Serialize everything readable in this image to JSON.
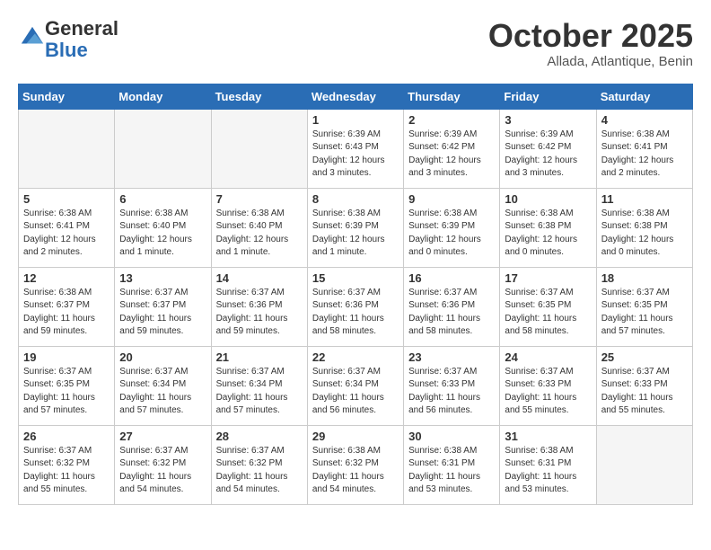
{
  "logo": {
    "general": "General",
    "blue": "Blue"
  },
  "header": {
    "month": "October 2025",
    "location": "Allada, Atlantique, Benin"
  },
  "weekdays": [
    "Sunday",
    "Monday",
    "Tuesday",
    "Wednesday",
    "Thursday",
    "Friday",
    "Saturday"
  ],
  "weeks": [
    [
      {
        "day": "",
        "info": ""
      },
      {
        "day": "",
        "info": ""
      },
      {
        "day": "",
        "info": ""
      },
      {
        "day": "1",
        "info": "Sunrise: 6:39 AM\nSunset: 6:43 PM\nDaylight: 12 hours\nand 3 minutes."
      },
      {
        "day": "2",
        "info": "Sunrise: 6:39 AM\nSunset: 6:42 PM\nDaylight: 12 hours\nand 3 minutes."
      },
      {
        "day": "3",
        "info": "Sunrise: 6:39 AM\nSunset: 6:42 PM\nDaylight: 12 hours\nand 3 minutes."
      },
      {
        "day": "4",
        "info": "Sunrise: 6:38 AM\nSunset: 6:41 PM\nDaylight: 12 hours\nand 2 minutes."
      }
    ],
    [
      {
        "day": "5",
        "info": "Sunrise: 6:38 AM\nSunset: 6:41 PM\nDaylight: 12 hours\nand 2 minutes."
      },
      {
        "day": "6",
        "info": "Sunrise: 6:38 AM\nSunset: 6:40 PM\nDaylight: 12 hours\nand 1 minute."
      },
      {
        "day": "7",
        "info": "Sunrise: 6:38 AM\nSunset: 6:40 PM\nDaylight: 12 hours\nand 1 minute."
      },
      {
        "day": "8",
        "info": "Sunrise: 6:38 AM\nSunset: 6:39 PM\nDaylight: 12 hours\nand 1 minute."
      },
      {
        "day": "9",
        "info": "Sunrise: 6:38 AM\nSunset: 6:39 PM\nDaylight: 12 hours\nand 0 minutes."
      },
      {
        "day": "10",
        "info": "Sunrise: 6:38 AM\nSunset: 6:38 PM\nDaylight: 12 hours\nand 0 minutes."
      },
      {
        "day": "11",
        "info": "Sunrise: 6:38 AM\nSunset: 6:38 PM\nDaylight: 12 hours\nand 0 minutes."
      }
    ],
    [
      {
        "day": "12",
        "info": "Sunrise: 6:38 AM\nSunset: 6:37 PM\nDaylight: 11 hours\nand 59 minutes."
      },
      {
        "day": "13",
        "info": "Sunrise: 6:37 AM\nSunset: 6:37 PM\nDaylight: 11 hours\nand 59 minutes."
      },
      {
        "day": "14",
        "info": "Sunrise: 6:37 AM\nSunset: 6:36 PM\nDaylight: 11 hours\nand 59 minutes."
      },
      {
        "day": "15",
        "info": "Sunrise: 6:37 AM\nSunset: 6:36 PM\nDaylight: 11 hours\nand 58 minutes."
      },
      {
        "day": "16",
        "info": "Sunrise: 6:37 AM\nSunset: 6:36 PM\nDaylight: 11 hours\nand 58 minutes."
      },
      {
        "day": "17",
        "info": "Sunrise: 6:37 AM\nSunset: 6:35 PM\nDaylight: 11 hours\nand 58 minutes."
      },
      {
        "day": "18",
        "info": "Sunrise: 6:37 AM\nSunset: 6:35 PM\nDaylight: 11 hours\nand 57 minutes."
      }
    ],
    [
      {
        "day": "19",
        "info": "Sunrise: 6:37 AM\nSunset: 6:35 PM\nDaylight: 11 hours\nand 57 minutes."
      },
      {
        "day": "20",
        "info": "Sunrise: 6:37 AM\nSunset: 6:34 PM\nDaylight: 11 hours\nand 57 minutes."
      },
      {
        "day": "21",
        "info": "Sunrise: 6:37 AM\nSunset: 6:34 PM\nDaylight: 11 hours\nand 57 minutes."
      },
      {
        "day": "22",
        "info": "Sunrise: 6:37 AM\nSunset: 6:34 PM\nDaylight: 11 hours\nand 56 minutes."
      },
      {
        "day": "23",
        "info": "Sunrise: 6:37 AM\nSunset: 6:33 PM\nDaylight: 11 hours\nand 56 minutes."
      },
      {
        "day": "24",
        "info": "Sunrise: 6:37 AM\nSunset: 6:33 PM\nDaylight: 11 hours\nand 55 minutes."
      },
      {
        "day": "25",
        "info": "Sunrise: 6:37 AM\nSunset: 6:33 PM\nDaylight: 11 hours\nand 55 minutes."
      }
    ],
    [
      {
        "day": "26",
        "info": "Sunrise: 6:37 AM\nSunset: 6:32 PM\nDaylight: 11 hours\nand 55 minutes."
      },
      {
        "day": "27",
        "info": "Sunrise: 6:37 AM\nSunset: 6:32 PM\nDaylight: 11 hours\nand 54 minutes."
      },
      {
        "day": "28",
        "info": "Sunrise: 6:37 AM\nSunset: 6:32 PM\nDaylight: 11 hours\nand 54 minutes."
      },
      {
        "day": "29",
        "info": "Sunrise: 6:38 AM\nSunset: 6:32 PM\nDaylight: 11 hours\nand 54 minutes."
      },
      {
        "day": "30",
        "info": "Sunrise: 6:38 AM\nSunset: 6:31 PM\nDaylight: 11 hours\nand 53 minutes."
      },
      {
        "day": "31",
        "info": "Sunrise: 6:38 AM\nSunset: 6:31 PM\nDaylight: 11 hours\nand 53 minutes."
      },
      {
        "day": "",
        "info": ""
      }
    ]
  ]
}
